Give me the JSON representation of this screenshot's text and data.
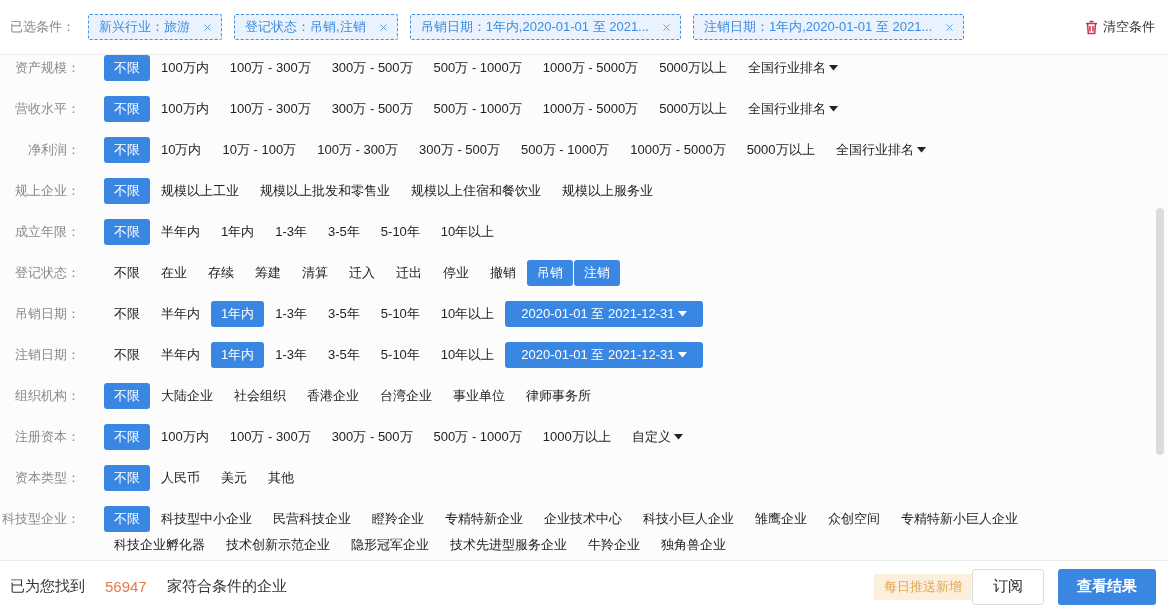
{
  "selected_conditions": {
    "label": "已选条件：",
    "chips": [
      {
        "text": "新兴行业：旅游"
      },
      {
        "text": "登记状态：吊销,注销"
      },
      {
        "text": "吊销日期：1年内,2020-01-01 至 2021..."
      },
      {
        "text": "注销日期：1年内,2020-01-01 至 2021..."
      }
    ],
    "clear_button": "清空条件"
  },
  "filters": [
    {
      "label": "资产规模：",
      "options": [
        {
          "text": "不限",
          "kind": "option",
          "selected": true
        },
        {
          "text": "100万内",
          "kind": "option",
          "selected": false
        },
        {
          "text": "100万 - 300万",
          "kind": "option",
          "selected": false
        },
        {
          "text": "300万 - 500万",
          "kind": "option",
          "selected": false
        },
        {
          "text": "500万 - 1000万",
          "kind": "option",
          "selected": false
        },
        {
          "text": "1000万 - 5000万",
          "kind": "option",
          "selected": false
        },
        {
          "text": "5000万以上",
          "kind": "option",
          "selected": false
        },
        {
          "text": "全国行业排名",
          "kind": "dropdown",
          "selected": false
        }
      ]
    },
    {
      "label": "营收水平：",
      "options": [
        {
          "text": "不限",
          "kind": "option",
          "selected": true
        },
        {
          "text": "100万内",
          "kind": "option",
          "selected": false
        },
        {
          "text": "100万 - 300万",
          "kind": "option",
          "selected": false
        },
        {
          "text": "300万 - 500万",
          "kind": "option",
          "selected": false
        },
        {
          "text": "500万 - 1000万",
          "kind": "option",
          "selected": false
        },
        {
          "text": "1000万 - 5000万",
          "kind": "option",
          "selected": false
        },
        {
          "text": "5000万以上",
          "kind": "option",
          "selected": false
        },
        {
          "text": "全国行业排名",
          "kind": "dropdown",
          "selected": false
        }
      ]
    },
    {
      "label": "净利润：",
      "options": [
        {
          "text": "不限",
          "kind": "option",
          "selected": true
        },
        {
          "text": "10万内",
          "kind": "option",
          "selected": false
        },
        {
          "text": "10万 - 100万",
          "kind": "option",
          "selected": false
        },
        {
          "text": "100万 - 300万",
          "kind": "option",
          "selected": false
        },
        {
          "text": "300万 - 500万",
          "kind": "option",
          "selected": false
        },
        {
          "text": "500万 - 1000万",
          "kind": "option",
          "selected": false
        },
        {
          "text": "1000万 - 5000万",
          "kind": "option",
          "selected": false
        },
        {
          "text": "5000万以上",
          "kind": "option",
          "selected": false
        },
        {
          "text": "全国行业排名",
          "kind": "dropdown",
          "selected": false
        }
      ]
    },
    {
      "label": "规上企业：",
      "options": [
        {
          "text": "不限",
          "kind": "option",
          "selected": true
        },
        {
          "text": "规模以上工业",
          "kind": "option",
          "selected": false
        },
        {
          "text": "规模以上批发和零售业",
          "kind": "option",
          "selected": false
        },
        {
          "text": "规模以上住宿和餐饮业",
          "kind": "option",
          "selected": false
        },
        {
          "text": "规模以上服务业",
          "kind": "option",
          "selected": false
        }
      ]
    },
    {
      "label": "成立年限：",
      "options": [
        {
          "text": "不限",
          "kind": "option",
          "selected": true
        },
        {
          "text": "半年内",
          "kind": "option",
          "selected": false
        },
        {
          "text": "1年内",
          "kind": "option",
          "selected": false
        },
        {
          "text": "1-3年",
          "kind": "option",
          "selected": false
        },
        {
          "text": "3-5年",
          "kind": "option",
          "selected": false
        },
        {
          "text": "5-10年",
          "kind": "option",
          "selected": false
        },
        {
          "text": "10年以上",
          "kind": "option",
          "selected": false
        }
      ]
    },
    {
      "label": "登记状态：",
      "options": [
        {
          "text": "不限",
          "kind": "option",
          "selected": false
        },
        {
          "text": "在业",
          "kind": "option",
          "selected": false
        },
        {
          "text": "存续",
          "kind": "option",
          "selected": false
        },
        {
          "text": "筹建",
          "kind": "option",
          "selected": false
        },
        {
          "text": "清算",
          "kind": "option",
          "selected": false
        },
        {
          "text": "迁入",
          "kind": "option",
          "selected": false
        },
        {
          "text": "迁出",
          "kind": "option",
          "selected": false
        },
        {
          "text": "停业",
          "kind": "option",
          "selected": false
        },
        {
          "text": "撤销",
          "kind": "option",
          "selected": false
        },
        {
          "text": "吊销",
          "kind": "option",
          "selected": true
        },
        {
          "text": "注销",
          "kind": "option",
          "selected": true
        }
      ]
    },
    {
      "label": "吊销日期：",
      "options": [
        {
          "text": "不限",
          "kind": "option",
          "selected": false
        },
        {
          "text": "半年内",
          "kind": "option",
          "selected": false
        },
        {
          "text": "1年内",
          "kind": "option",
          "selected": true
        },
        {
          "text": "1-3年",
          "kind": "option",
          "selected": false
        },
        {
          "text": "3-5年",
          "kind": "option",
          "selected": false
        },
        {
          "text": "5-10年",
          "kind": "option",
          "selected": false
        },
        {
          "text": "10年以上",
          "kind": "option",
          "selected": false
        },
        {
          "text": "2020-01-01 至 2021-12-31",
          "kind": "range",
          "selected": true
        }
      ]
    },
    {
      "label": "注销日期：",
      "options": [
        {
          "text": "不限",
          "kind": "option",
          "selected": false
        },
        {
          "text": "半年内",
          "kind": "option",
          "selected": false
        },
        {
          "text": "1年内",
          "kind": "option",
          "selected": true
        },
        {
          "text": "1-3年",
          "kind": "option",
          "selected": false
        },
        {
          "text": "3-5年",
          "kind": "option",
          "selected": false
        },
        {
          "text": "5-10年",
          "kind": "option",
          "selected": false
        },
        {
          "text": "10年以上",
          "kind": "option",
          "selected": false
        },
        {
          "text": "2020-01-01 至 2021-12-31",
          "kind": "range",
          "selected": true
        }
      ]
    },
    {
      "label": "组织机构：",
      "options": [
        {
          "text": "不限",
          "kind": "option",
          "selected": true
        },
        {
          "text": "大陆企业",
          "kind": "option",
          "selected": false
        },
        {
          "text": "社会组织",
          "kind": "option",
          "selected": false
        },
        {
          "text": "香港企业",
          "kind": "option",
          "selected": false
        },
        {
          "text": "台湾企业",
          "kind": "option",
          "selected": false
        },
        {
          "text": "事业单位",
          "kind": "option",
          "selected": false
        },
        {
          "text": "律师事务所",
          "kind": "option",
          "selected": false
        }
      ]
    },
    {
      "label": "注册资本：",
      "options": [
        {
          "text": "不限",
          "kind": "option",
          "selected": true
        },
        {
          "text": "100万内",
          "kind": "option",
          "selected": false
        },
        {
          "text": "100万 - 300万",
          "kind": "option",
          "selected": false
        },
        {
          "text": "300万 - 500万",
          "kind": "option",
          "selected": false
        },
        {
          "text": "500万 - 1000万",
          "kind": "option",
          "selected": false
        },
        {
          "text": "1000万以上",
          "kind": "option",
          "selected": false
        },
        {
          "text": "自定义",
          "kind": "dropdown",
          "selected": false
        }
      ]
    },
    {
      "label": "资本类型：",
      "options": [
        {
          "text": "不限",
          "kind": "option",
          "selected": true
        },
        {
          "text": "人民币",
          "kind": "option",
          "selected": false
        },
        {
          "text": "美元",
          "kind": "option",
          "selected": false
        },
        {
          "text": "其他",
          "kind": "option",
          "selected": false
        }
      ]
    },
    {
      "label": "科技型企业：",
      "options": [
        {
          "text": "不限",
          "kind": "option",
          "selected": true
        },
        {
          "text": "科技型中小企业",
          "kind": "option",
          "selected": false
        },
        {
          "text": "民营科技企业",
          "kind": "option",
          "selected": false
        },
        {
          "text": "瞪羚企业",
          "kind": "option",
          "selected": false
        },
        {
          "text": "专精特新企业",
          "kind": "option",
          "selected": false
        },
        {
          "text": "企业技术中心",
          "kind": "option",
          "selected": false
        },
        {
          "text": "科技小巨人企业",
          "kind": "option",
          "selected": false
        },
        {
          "text": "雏鹰企业",
          "kind": "option",
          "selected": false
        },
        {
          "text": "众创空间",
          "kind": "option",
          "selected": false
        },
        {
          "text": "专精特新小巨人企业",
          "kind": "option",
          "selected": false
        },
        {
          "text": "科技企业孵化器",
          "kind": "option",
          "selected": false
        },
        {
          "text": "技术创新示范企业",
          "kind": "option",
          "selected": false
        },
        {
          "text": "隐形冠军企业",
          "kind": "option",
          "selected": false
        },
        {
          "text": "技术先进型服务企业",
          "kind": "option",
          "selected": false
        },
        {
          "text": "牛羚企业",
          "kind": "option",
          "selected": false
        },
        {
          "text": "独角兽企业",
          "kind": "option",
          "selected": false
        }
      ]
    }
  ],
  "footer": {
    "found_prefix": "已为您找到",
    "count": "56947",
    "found_suffix": "家符合条件的企业",
    "push_tip": "每日推送新增",
    "subscribe_button": "订阅",
    "results_button": "查看结果"
  }
}
